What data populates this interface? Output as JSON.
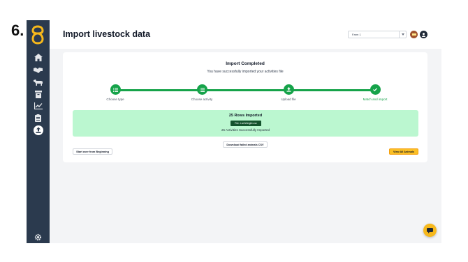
{
  "step_number": "6.",
  "header": {
    "title": "Import livestock data"
  },
  "farm_selector": {
    "value": "Farm 1"
  },
  "sidebar": {
    "items": [
      {
        "icon": "home-icon"
      },
      {
        "icon": "handshake-icon"
      },
      {
        "icon": "cow-icon"
      },
      {
        "icon": "archive-icon"
      },
      {
        "icon": "chart-icon"
      },
      {
        "icon": "clipboard-icon"
      },
      {
        "icon": "upload-icon",
        "active": true
      },
      {
        "icon": "gear-icon"
      }
    ]
  },
  "card": {
    "title": "Import Completed",
    "subtitle": "You have successfully imported your activities file",
    "steps": [
      {
        "label": "Choose type",
        "icon": "list-icon"
      },
      {
        "label": "Choose activity",
        "icon": "list-icon"
      },
      {
        "label": "Upload file",
        "icon": "upload-icon"
      },
      {
        "label": "Match and import",
        "icon": "check-icon"
      }
    ],
    "banner": {
      "title": "25 Rows Imported",
      "file_label": "File: LiveWeight.csv",
      "subtitle": "25 Activities Successfully Imported"
    },
    "download_button": "Download failed animals CSV",
    "start_over_button": "Start over from Beginning",
    "view_all_button": "View All Animals"
  },
  "colors": {
    "sidebar": "#2b3a4e",
    "accent_green": "#16a34a",
    "banner_bg": "#bbf7d0",
    "brand_yellow": "#f6b81c"
  }
}
